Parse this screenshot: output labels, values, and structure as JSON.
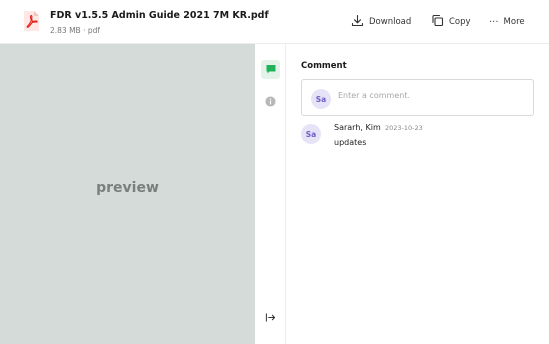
{
  "file": {
    "name": "FDR v1.5.5 Admin Guide 2021 7M KR.pdf",
    "meta": "2.83 MB · pdf",
    "icon": "pdf-file-icon"
  },
  "toolbar": {
    "download_label": "Download",
    "copy_label": "Copy",
    "more_label": "More",
    "more_glyph": "···"
  },
  "preview": {
    "label": "preview"
  },
  "rail": {
    "items": [
      "comment-icon",
      "info-icon",
      "expand-panel-icon"
    ]
  },
  "comments": {
    "title": "Comment",
    "input": {
      "avatar_initials": "Sa",
      "placeholder": "Enter a comment."
    },
    "items": [
      {
        "avatar_initials": "Sa",
        "author": "Sararh, Kim",
        "date": "2023-10-23",
        "text": "updates"
      }
    ]
  },
  "colors": {
    "preview_bg": "#d4dbd8",
    "accent_green": "#22b35a",
    "avatar_bg": "#e6e3f7",
    "avatar_text": "#6b5fc7",
    "pdf_red": "#e2231a"
  }
}
